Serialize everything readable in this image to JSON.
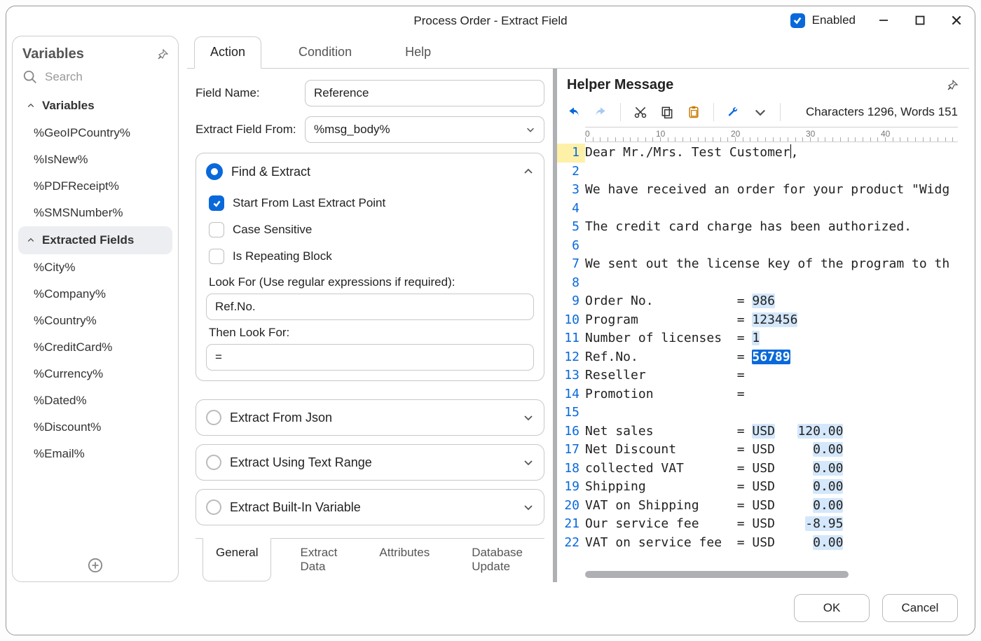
{
  "window": {
    "title": "Process Order - Extract Field",
    "enabled_label": "Enabled"
  },
  "buttons": {
    "ok": "OK",
    "cancel": "Cancel"
  },
  "sidebar": {
    "title": "Variables",
    "search_placeholder": "Search",
    "groups": [
      {
        "label": "Variables",
        "expanded": true,
        "items": [
          "%GeoIPCountry%",
          "%IsNew%",
          "%PDFReceipt%",
          "%SMSNumber%"
        ]
      },
      {
        "label": "Extracted Fields",
        "expanded": true,
        "items": [
          "%City%",
          "%Company%",
          "%Country%",
          "%CreditCard%",
          "%Currency%",
          "%Dated%",
          "%Discount%",
          "%Email%"
        ]
      }
    ]
  },
  "tabs": {
    "items": [
      "Action",
      "Condition",
      "Help"
    ],
    "active": 0
  },
  "form": {
    "field_name_label": "Field Name:",
    "field_name_value": "Reference",
    "extract_from_label": "Extract Field From:",
    "extract_from_value": "%msg_body%",
    "section_find": "Find & Extract",
    "start_last": "Start From Last Extract Point",
    "case_sensitive": "Case Sensitive",
    "repeating": "Is Repeating Block",
    "look_for_label": "Look For (Use regular expressions if required):",
    "look_for_value": "Ref.No.",
    "then_look_label": "Then Look For:",
    "then_look_value": "=",
    "collapsed_sections": [
      "Extract From Json",
      "Extract Using Text Range",
      "Extract Built-In Variable"
    ]
  },
  "bottom_tabs": {
    "items": [
      "General",
      "Extract Data",
      "Attributes",
      "Database Update"
    ],
    "active": 0
  },
  "helper": {
    "title": "Helper Message",
    "status": "Characters 1296, Words 151",
    "ruler_ticks": [
      0,
      10,
      20,
      30,
      40
    ],
    "lines": [
      {
        "n": 1,
        "text": "Dear Mr./Mrs. Test Customer,"
      },
      {
        "n": 2,
        "text": ""
      },
      {
        "n": 3,
        "text": "We have received an order for your product \"Widg"
      },
      {
        "n": 4,
        "text": ""
      },
      {
        "n": 5,
        "text": "The credit card charge has been authorized."
      },
      {
        "n": 6,
        "text": ""
      },
      {
        "n": 7,
        "text": "We sent out the license key of the program to th"
      },
      {
        "n": 8,
        "text": ""
      },
      {
        "n": 9,
        "segments": [
          [
            "Order No.           = ",
            ""
          ],
          [
            "986",
            "hl"
          ]
        ]
      },
      {
        "n": 10,
        "segments": [
          [
            "Program             = ",
            ""
          ],
          [
            "123456",
            "hl"
          ]
        ]
      },
      {
        "n": 11,
        "segments": [
          [
            "Number of licenses  = ",
            ""
          ],
          [
            "1",
            "hl"
          ]
        ]
      },
      {
        "n": 12,
        "segments": [
          [
            "Ref.No.             = ",
            ""
          ],
          [
            "56789",
            "hlstrong"
          ]
        ]
      },
      {
        "n": 13,
        "text": "Reseller            ="
      },
      {
        "n": 14,
        "text": "Promotion           ="
      },
      {
        "n": 15,
        "text": ""
      },
      {
        "n": 16,
        "segments": [
          [
            "Net sales           = ",
            ""
          ],
          [
            "USD",
            "hl"
          ],
          [
            "   ",
            ""
          ],
          [
            "120.00",
            "hl"
          ]
        ]
      },
      {
        "n": 17,
        "segments": [
          [
            "Net Discount        = USD     ",
            ""
          ],
          [
            "0.00",
            "hl"
          ]
        ]
      },
      {
        "n": 18,
        "segments": [
          [
            "collected VAT       = USD     ",
            ""
          ],
          [
            "0.00",
            "hl"
          ]
        ]
      },
      {
        "n": 19,
        "segments": [
          [
            "Shipping            = USD     ",
            ""
          ],
          [
            "0.00",
            "hl"
          ]
        ]
      },
      {
        "n": 20,
        "segments": [
          [
            "VAT on Shipping     = USD     ",
            ""
          ],
          [
            "0.00",
            "hl"
          ]
        ]
      },
      {
        "n": 21,
        "segments": [
          [
            "Our service fee     = USD    ",
            ""
          ],
          [
            "-8.95",
            "hl"
          ]
        ]
      },
      {
        "n": 22,
        "segments": [
          [
            "VAT on service fee  = USD     ",
            ""
          ],
          [
            "0.00",
            "hl"
          ]
        ]
      }
    ]
  }
}
